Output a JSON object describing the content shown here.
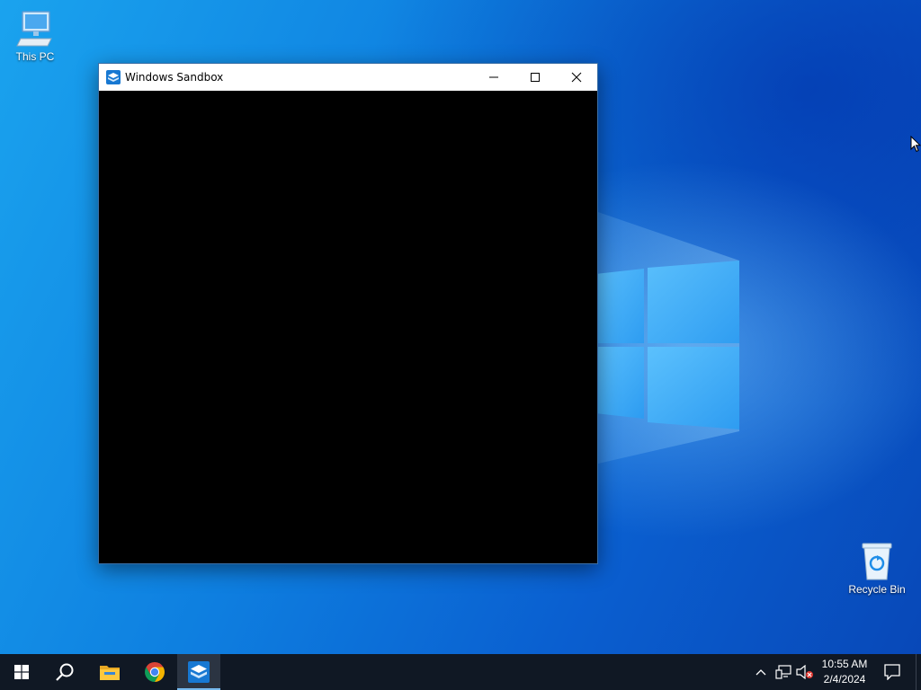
{
  "desktop": {
    "icons": [
      {
        "label": "This PC",
        "icon": "computer-icon"
      },
      {
        "label": "Recycle Bin",
        "icon": "recycle-bin-icon"
      }
    ],
    "colors": {
      "wallpaper_accent": "#0e7fe0",
      "logo_light": "#7fd0ff"
    }
  },
  "window": {
    "title": "Windows Sandbox",
    "app_icon": "sandbox-icon",
    "controls": {
      "minimize": "minimize-icon",
      "maximize": "maximize-icon",
      "close": "close-icon"
    },
    "content_color": "#000000"
  },
  "taskbar": {
    "buttons": [
      {
        "name": "start",
        "icon": "windows-start-icon"
      },
      {
        "name": "search",
        "icon": "search-icon"
      },
      {
        "name": "file-explorer",
        "icon": "folder-icon"
      },
      {
        "name": "google-chrome",
        "icon": "chrome-icon"
      },
      {
        "name": "windows-sandbox",
        "icon": "sandbox-icon",
        "active": true
      }
    ],
    "tray": {
      "icons": [
        "chevron-up-icon",
        "network-icon",
        "volume-muted-icon"
      ],
      "time": "10:55 AM",
      "date": "2/4/2024"
    },
    "notifications_icon": "action-center-icon",
    "color": "#101824"
  }
}
